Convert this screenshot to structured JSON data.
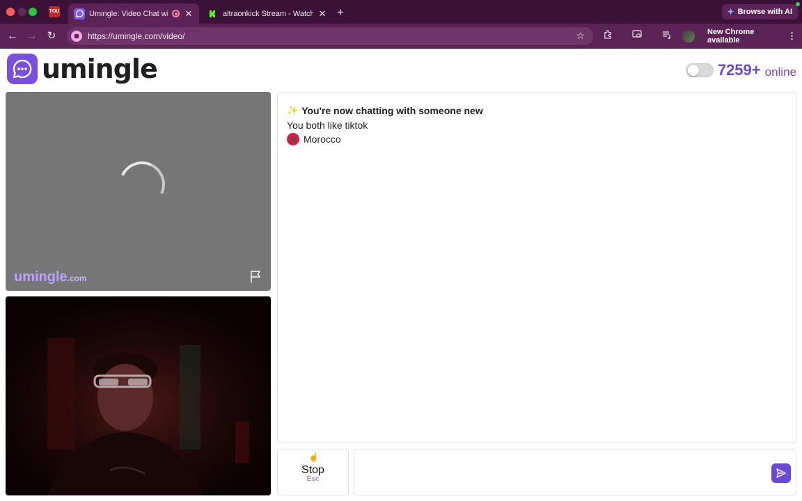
{
  "browser": {
    "tabs": [
      {
        "title": "Umingle: Video Chat with",
        "favicon": "umingle-icon",
        "recording": true,
        "active": true
      },
      {
        "title": "altraonkick Stream - Watch L",
        "favicon": "kick-icon",
        "active": false
      }
    ],
    "pinned_tab_label": "TOU",
    "ai_button_label": "Browse with AI",
    "url": "https://umingle.com/video/",
    "update_label": "New Chrome available"
  },
  "header": {
    "logo_text": "umingle",
    "online_count": "7259+",
    "online_label": "online"
  },
  "stranger_video": {
    "watermark_main": "umingle",
    "watermark_suffix": ".com",
    "state": "loading"
  },
  "chat": {
    "intro": "You're now chatting with someone new",
    "common_interest": "You both like tiktok",
    "country": "Morocco"
  },
  "controls": {
    "stop_label": "Stop",
    "stop_shortcut": "Esc",
    "message_value": ""
  },
  "colors": {
    "brand": "#6a49d6",
    "chrome_frame": "#3b1237",
    "chrome_toolbar": "#5c2356",
    "country_flag": "#d61f46"
  }
}
